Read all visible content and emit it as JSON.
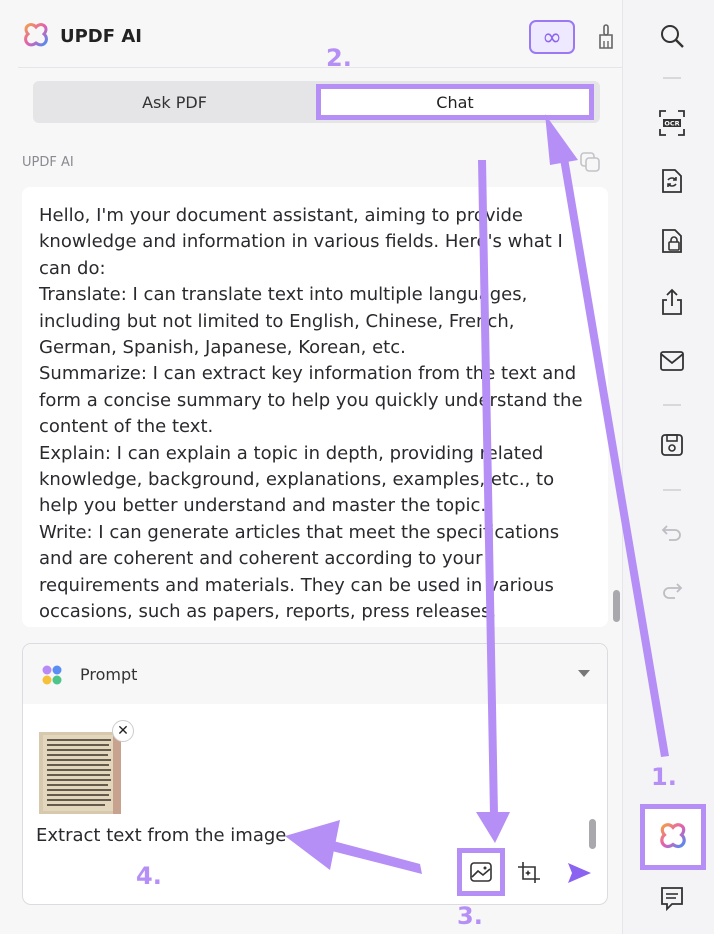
{
  "header": {
    "app_title": "UPDF AI",
    "infinity_label": "∞"
  },
  "tabs": {
    "ask_pdf": "Ask PDF",
    "chat": "Chat"
  },
  "chat": {
    "sender": "UPDF AI",
    "message_lines": [
      "Hello, I'm your document assistant, aiming to provide knowledge and information in various fields. Here's what I can do:",
      "Translate: I can translate text into multiple languages, including but not limited to English, Chinese, French, German, Spanish, Japanese, Korean, etc.",
      "Summarize: I can extract key information from the text and form a concise summary to help you quickly understand the content of the text.",
      "Explain: I can explain a topic in depth, providing related knowledge, background, explanations, examples, etc., to help you better understand and master the topic.",
      "Write: I can generate articles that meet the specifications and are coherent and coherent according to your requirements and materials. They can be used in various occasions, such as papers, reports, press releases, advertising copy, etc."
    ]
  },
  "prompt": {
    "label": "Prompt",
    "input_value": "Extract text from the image",
    "close_label": "✕"
  },
  "annotations": {
    "step1": "1.",
    "step2": "2.",
    "step3": "3.",
    "step4": "4."
  },
  "colors": {
    "highlight": "#b58ff6",
    "accent": "#8a63f0"
  },
  "icons": [
    "updf-logo-icon",
    "infinity-icon",
    "broom-icon",
    "copy-icon",
    "prompt-dots-icon",
    "chevron-down-icon",
    "image-icon",
    "crop-icon",
    "send-icon",
    "search-icon",
    "ocr-icon",
    "convert-icon",
    "protect-icon",
    "share-icon",
    "mail-icon",
    "save-icon",
    "undo-icon",
    "redo-icon",
    "ai-assistant-icon",
    "comment-icon"
  ]
}
